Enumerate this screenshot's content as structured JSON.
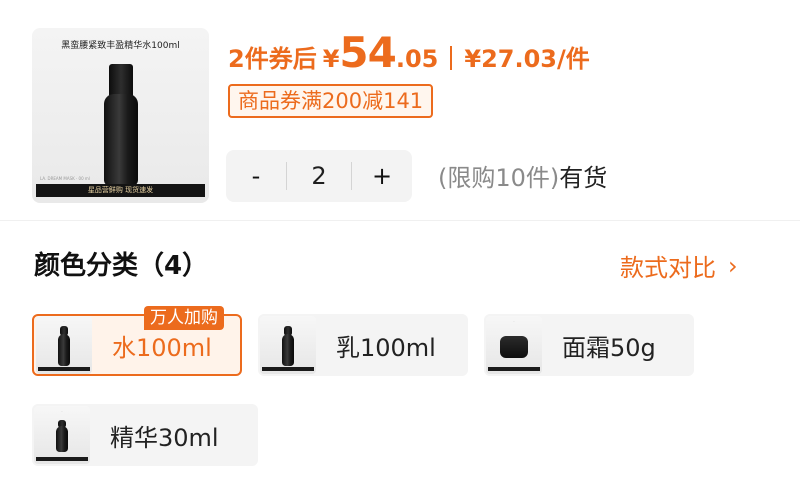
{
  "product": {
    "thumb_caption": "黑蛮腰紧致丰盈精华水100ml",
    "thumb_tiny": "LA. DREAM MASK · 00 ml",
    "thumb_bar": "星品营鲜购 现货速发"
  },
  "price": {
    "prefix": "2件券后",
    "yen": "¥",
    "integer": "54",
    "decimal": ".05",
    "per_item": "¥27.03/件"
  },
  "coupon": {
    "label": "商品券满200减141"
  },
  "quantity": {
    "minus": "-",
    "value": "2",
    "plus": "+",
    "limit": "(限购10件)",
    "stock": "有货"
  },
  "variants": {
    "title": "颜色分类（4）",
    "compare_label": "款式对比",
    "compare_icon": "chevron-right-icon",
    "hot_badge": "万人加购",
    "items": [
      {
        "label": "水100ml",
        "selected": true
      },
      {
        "label": "乳100ml",
        "selected": false
      },
      {
        "label": "面霜50g",
        "selected": false
      },
      {
        "label": "精华30ml",
        "selected": false
      }
    ]
  },
  "colors": {
    "accent": "#ec6b1d",
    "option_bg": "#f4f4f4",
    "selected_bg": "#fff3ea"
  }
}
